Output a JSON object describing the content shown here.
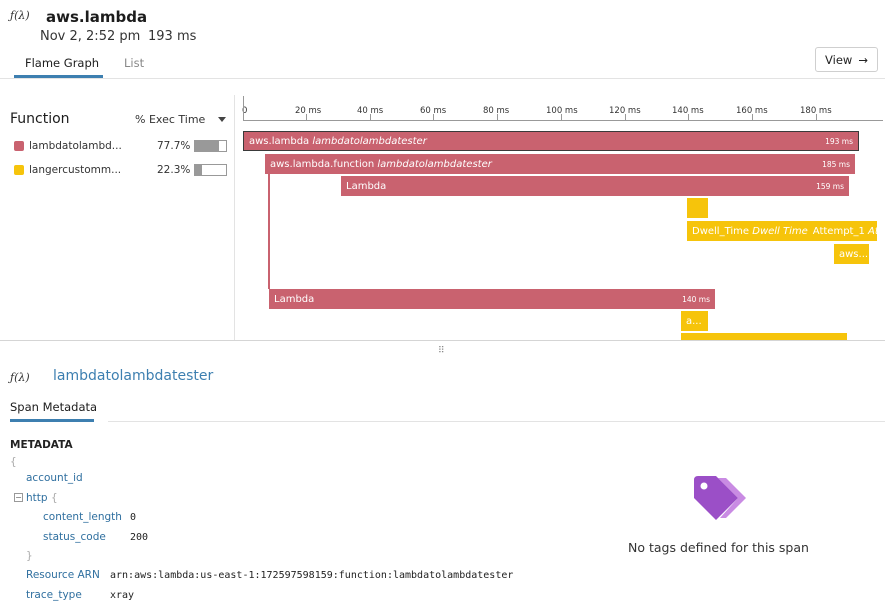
{
  "header": {
    "icon": "lambda-function-icon",
    "title": "aws.lambda",
    "datetime": "Nov 2, 2:52 pm",
    "duration": "193 ms",
    "view_label": "View",
    "tabs": [
      {
        "label": "Flame Graph",
        "active": true
      },
      {
        "label": "List",
        "active": false
      }
    ]
  },
  "legend": {
    "function_header": "Function",
    "exec_header": "% Exec Time",
    "rows": [
      {
        "name": "lambdatolambd...",
        "pct_label": "77.7%",
        "pct": 77.7,
        "color": "#c9626f"
      },
      {
        "name": "langercustomm...",
        "pct_label": "22.3%",
        "pct": 22.3,
        "color": "#f6c40b"
      }
    ]
  },
  "flame": {
    "ticks": [
      "0",
      "20 ms",
      "40 ms",
      "60 ms",
      "80 ms",
      "100 ms",
      "120 ms",
      "140 ms",
      "160 ms",
      "180 ms"
    ],
    "spans": [
      {
        "service": "aws.lambda",
        "resource": "lambdatolambdatester",
        "duration": "193 ms"
      },
      {
        "service": "aws.lambda.function",
        "resource": "lambdatolambdatester",
        "duration": "185 ms"
      },
      {
        "service": "Lambda",
        "resource": "",
        "duration": "159 ms"
      },
      {
        "service": "Dwell_Time",
        "resource": "Dwell Time",
        "extra": "Attempt_1",
        "extra_resource": "Att..."
      },
      {
        "service": "aws...",
        "resource": ""
      },
      {
        "service": "Lambda",
        "resource": "",
        "duration": "140 ms"
      },
      {
        "service": "a...",
        "resource": ""
      }
    ]
  },
  "detail": {
    "span_name": "lambdatolambdatester",
    "tab_label": "Span Metadata",
    "metadata_title": "METADATA",
    "open_brace": "{",
    "close_brace": "}",
    "account_id_key": "account_id",
    "http_key": "http",
    "content_length_key": "content_length",
    "content_length_val": "0",
    "status_code_key": "status_code",
    "status_code_val": "200",
    "resource_arn_key": "Resource ARN",
    "resource_arn_val": "arn:aws:lambda:us-east-1:172597598159:function:lambdatolambdatester",
    "trace_type_key": "trace_type",
    "trace_type_val": "xray",
    "no_tags": "No tags defined for this span"
  },
  "colors": {
    "primary": "#c9626f",
    "secondary": "#f6c40b",
    "link": "#3d7fb0",
    "tag_icon": "#9b4fc7"
  }
}
